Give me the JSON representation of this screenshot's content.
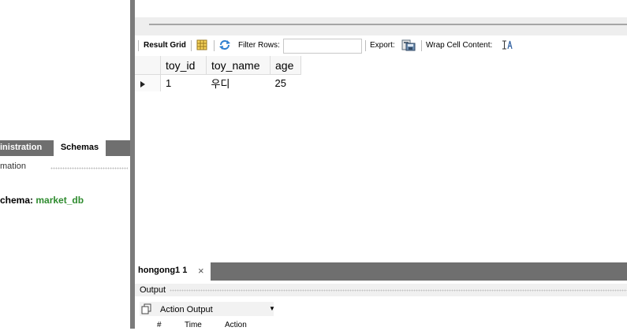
{
  "left_panel": {
    "tabs": [
      "inistration",
      "Schemas"
    ],
    "info_label": "mation",
    "schema_prefix": "chema: ",
    "schema_name": "market_db"
  },
  "result_toolbar": {
    "result_grid_label": "Result Grid",
    "filter_rows_label": "Filter Rows:",
    "filter_value": "",
    "export_label": "Export:",
    "wrap_label": "Wrap Cell Content:"
  },
  "grid": {
    "columns": [
      "toy_id",
      "toy_name",
      "age"
    ],
    "rows": [
      [
        "1",
        "우디",
        "25"
      ]
    ]
  },
  "bottom": {
    "tab_label": "hongong1 1",
    "close_glyph": "×",
    "output_label": "Output",
    "dropdown_value": "Action Output",
    "columns": [
      "#",
      "Time",
      "Action"
    ]
  },
  "colors": {
    "schema_green": "#2e8b2e",
    "panel_gray": "#6f6f6f"
  }
}
